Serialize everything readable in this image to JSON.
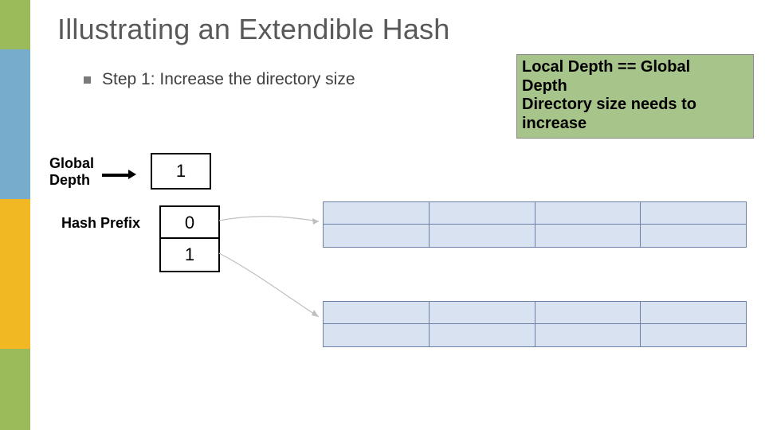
{
  "title": "Illustrating an Extendible Hash",
  "bullet": "Step 1: Increase the directory size",
  "callout_line1": "Local Depth == Global",
  "callout_line2": "Depth",
  "callout_line3": "Directory size needs to",
  "callout_line4": "increase",
  "global_depth_label_l1": "Global",
  "global_depth_label_l2": "Depth",
  "global_depth_value": "1",
  "hash_prefix_label": "Hash Prefix",
  "directory": {
    "slot0": "0",
    "slot1": "1"
  }
}
